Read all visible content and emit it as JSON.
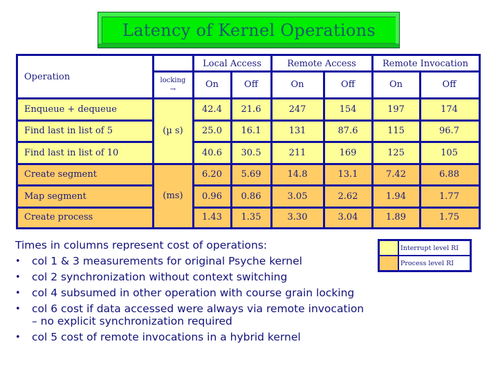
{
  "title": "Latency of Kernel Operations",
  "colors": {
    "interrupt_level": "#ffff99",
    "process_level": "#ffcc66",
    "border": "#1010a0",
    "title_bg": "#00ee00"
  },
  "table": {
    "operation_header": "Operation",
    "locking_header": "locking",
    "locking_arrow": "→",
    "groups": [
      "Local Access",
      "Remote Access",
      "Remote Invocation"
    ],
    "subheaders": [
      "On",
      "Off",
      "On",
      "Off",
      "On",
      "Off"
    ],
    "units": {
      "interrupt": "(µ s)",
      "process": "(ms)"
    },
    "rows": [
      {
        "op": "Enqueue + dequeue",
        "level": "interrupt",
        "values": [
          "42.4",
          "21.6",
          "247",
          "154",
          "197",
          "174"
        ]
      },
      {
        "op": "Find last in list of 5",
        "level": "interrupt",
        "values": [
          "25.0",
          "16.1",
          "131",
          "87.6",
          "115",
          "96.7"
        ]
      },
      {
        "op": "Find last in list of 10",
        "level": "interrupt",
        "values": [
          "40.6",
          "30.5",
          "211",
          "169",
          "125",
          "105"
        ]
      },
      {
        "op": "Create segment",
        "level": "process",
        "values": [
          "6.20",
          "5.69",
          "14.8",
          "13.1",
          "7.42",
          "6.88"
        ]
      },
      {
        "op": "Map segment",
        "level": "process",
        "values": [
          "0.96",
          "0.86",
          "3.05",
          "2.62",
          "1.94",
          "1.77"
        ]
      },
      {
        "op": "Create process",
        "level": "process",
        "values": [
          "1.43",
          "1.35",
          "3.30",
          "3.04",
          "1.89",
          "1.75"
        ]
      }
    ]
  },
  "legend": {
    "items": [
      {
        "label": "Interrupt level RI",
        "level": "interrupt"
      },
      {
        "label": "Process level RI",
        "level": "process"
      }
    ]
  },
  "notes": {
    "intro": "Times in columns represent cost of operations:",
    "bullet_glyph": "•",
    "items": [
      {
        "text": "col 1 & 3 measurements for original Psyche kernel"
      },
      {
        "text": "col 2  synchronization without context switching"
      },
      {
        "text": "col 4 subsumed in other operation with course grain locking"
      },
      {
        "text": "col 6 cost if data accessed were always via remote invocation",
        "sub": "– no explicit synchronization required"
      },
      {
        "text": "col 5 cost of remote invocations in a hybrid kernel"
      }
    ]
  }
}
